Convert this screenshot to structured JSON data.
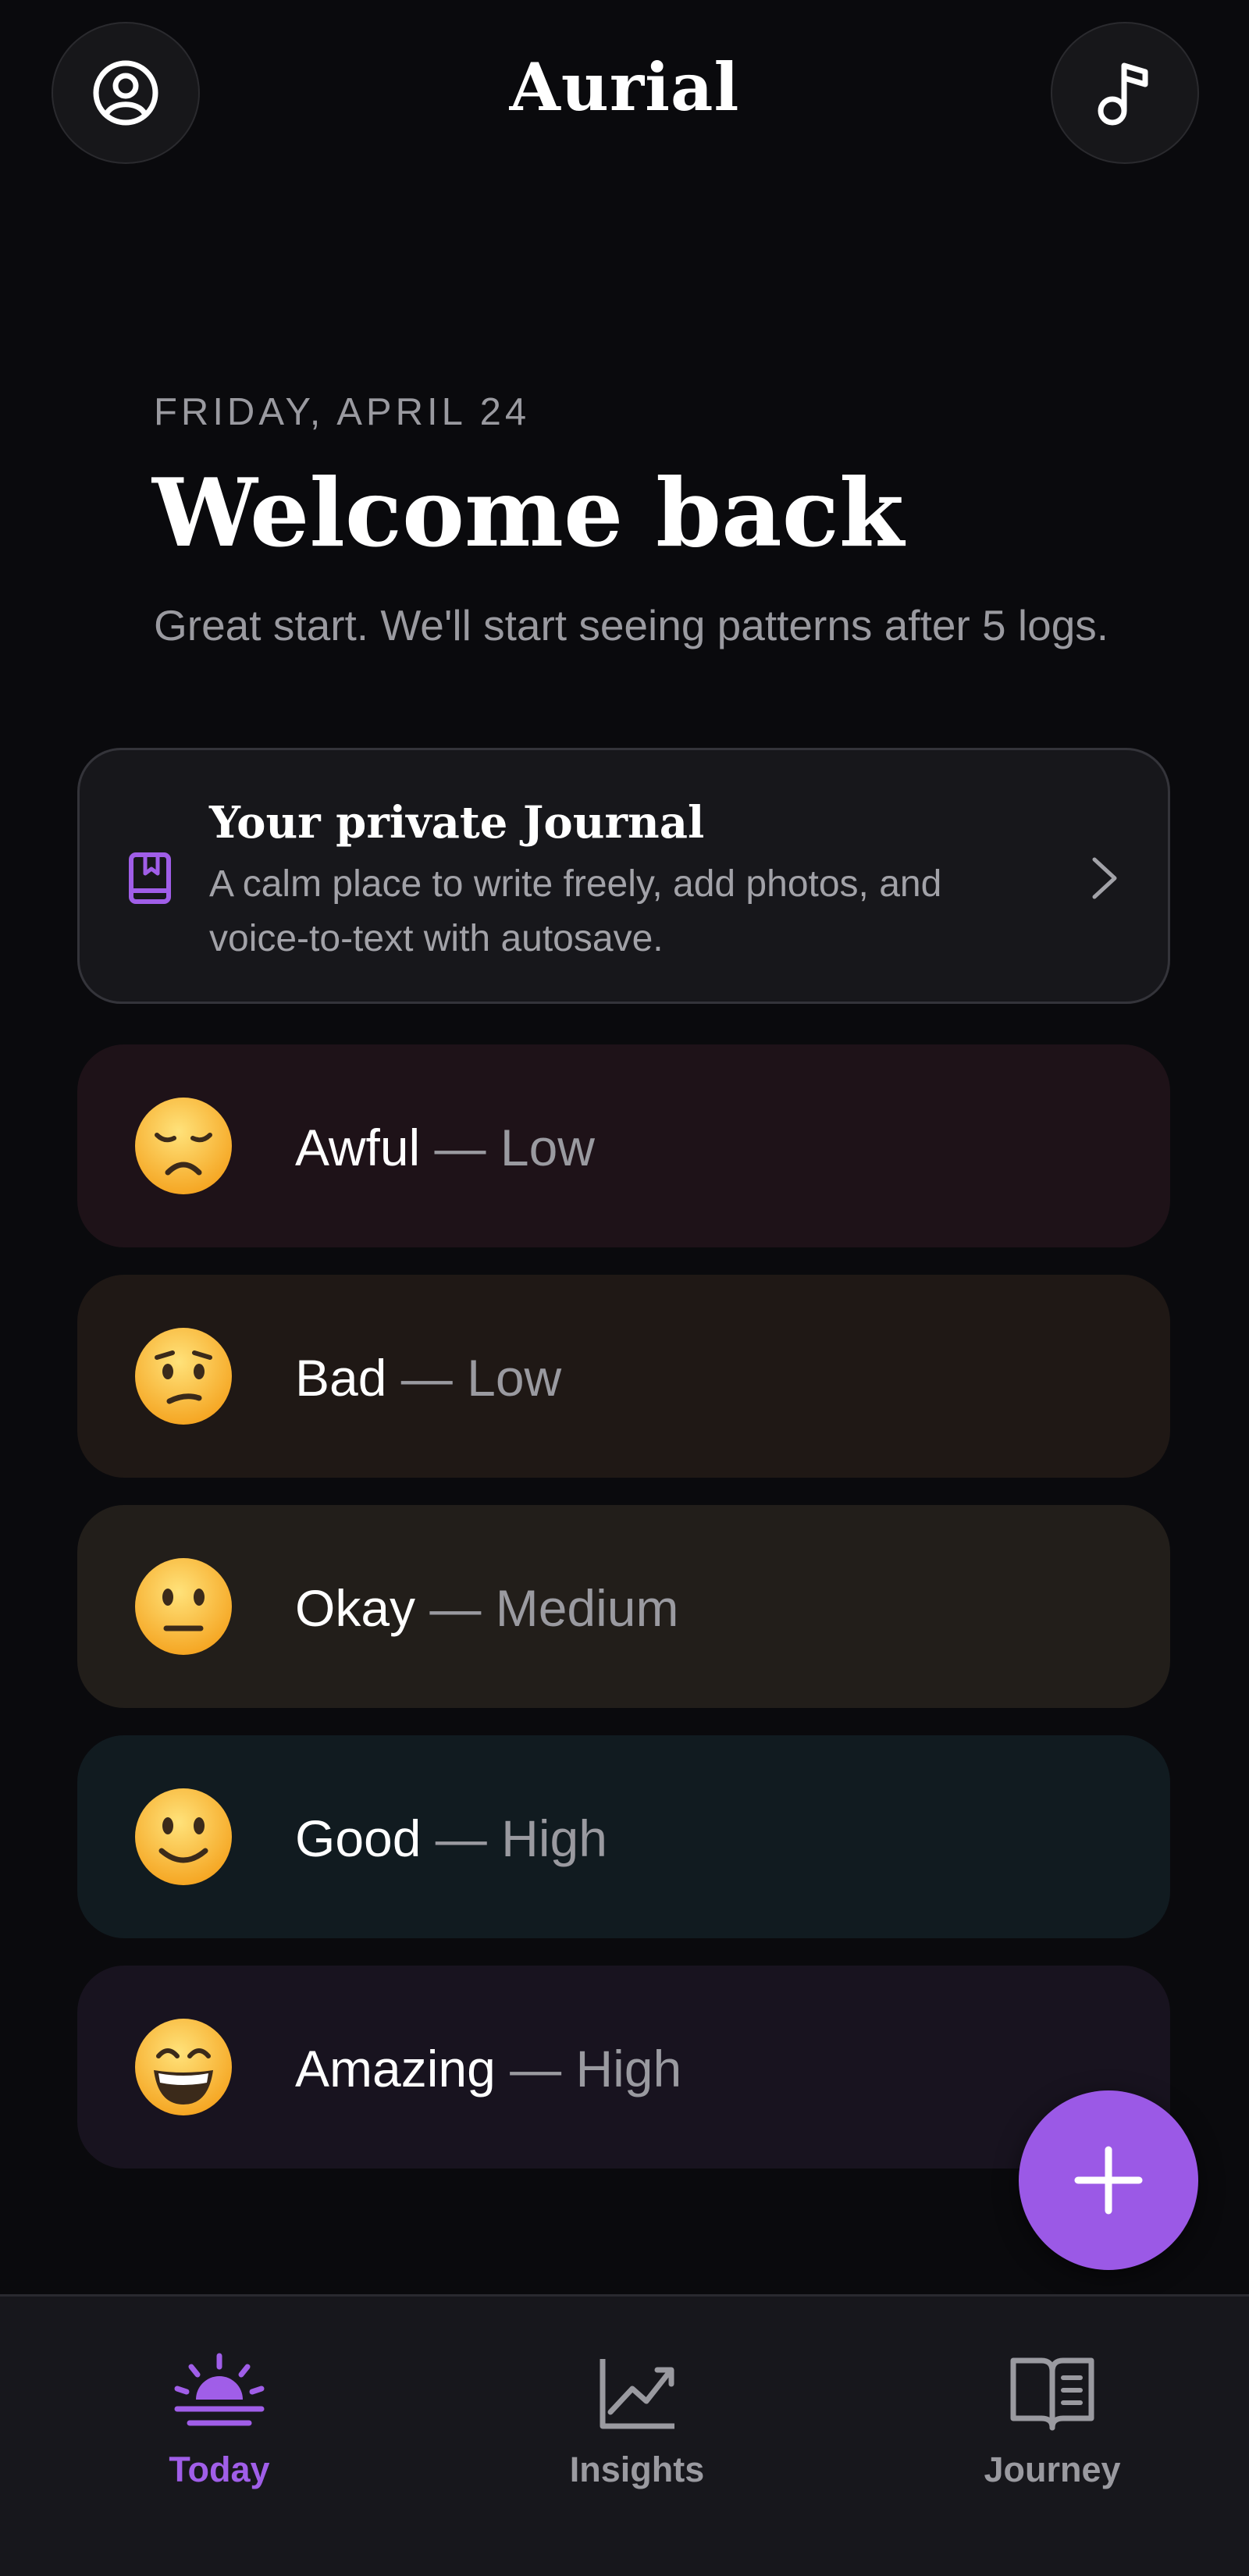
{
  "header": {
    "title": "Aurial",
    "left_icon": "profile-icon",
    "right_icon": "music-note-icon"
  },
  "welcome": {
    "date": "FRIDAY, APRIL 24",
    "heading": "Welcome back",
    "subtext": "Great start. We'll start seeing patterns after 5 logs."
  },
  "journal_card": {
    "icon": "book-icon",
    "title": "Your private Journal",
    "description": "A calm place to write freely, add photos, and voice-to-text with autosave."
  },
  "moods": [
    {
      "emoji": "😞",
      "label": "Awful",
      "separator": " — ",
      "level": "Low"
    },
    {
      "emoji": "😕",
      "label": "Bad",
      "separator": " — ",
      "level": "Low"
    },
    {
      "emoji": "😐",
      "label": "Okay",
      "separator": " — ",
      "level": "Medium"
    },
    {
      "emoji": "🙂",
      "label": "Good",
      "separator": " — ",
      "level": "High"
    },
    {
      "emoji": "😄",
      "label": "Amazing",
      "separator": " — ",
      "level": "High"
    }
  ],
  "fab": {
    "icon": "plus-icon"
  },
  "bottom_nav": {
    "items": [
      {
        "label": "Today",
        "icon": "sunrise-icon",
        "active": true
      },
      {
        "label": "Insights",
        "icon": "chart-line-icon",
        "active": false
      },
      {
        "label": "Journey",
        "icon": "open-book-icon",
        "active": false
      }
    ]
  },
  "colors": {
    "background": "#0a0a0d",
    "accent": "#9b59e6",
    "muted_text": "#9a9aa0"
  }
}
